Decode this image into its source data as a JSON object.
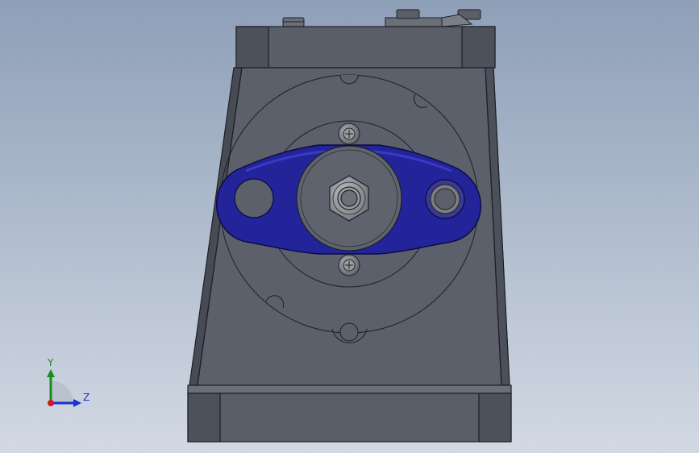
{
  "viewport": {
    "background_top": "#8e9fb8",
    "background_bottom": "#d2d9e3"
  },
  "model": {
    "body_color": "#595e69",
    "body_dark": "#474b55",
    "edge_color": "#1e2026",
    "flange_color": "#23239a",
    "flange_highlight": "#3a3ac8",
    "hub_color": "#5e636e",
    "nut_color": "#8a8d92"
  },
  "triad": {
    "y_label": "Y",
    "z_label": "Z",
    "y_color": "#1a8a1a",
    "z_color": "#1a33cc",
    "x_color": "#cc1a1a"
  }
}
